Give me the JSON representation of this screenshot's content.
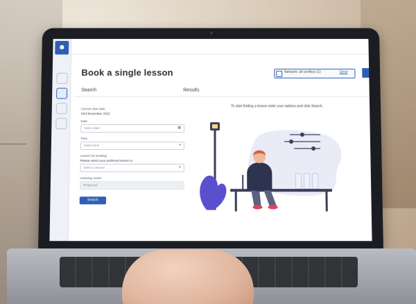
{
  "app": {
    "page_title": "Book a single lesson",
    "network_pill": {
      "text": "Network: all conflicts (1)",
      "link": "Clear"
    }
  },
  "sections": {
    "search": "Search",
    "results": "Results"
  },
  "form": {
    "current_date_label": "Current start date",
    "current_date_value": "23rd November 2022",
    "date_label": "Date",
    "date_placeholder": "Select date",
    "time_label": "Time",
    "time_placeholder": "Select time",
    "lesson_label": "Lesson for booking",
    "lesson_help": "Please select your preferred lesson to",
    "lesson_placeholder": "Select a lesson",
    "learning_label": "Learning centre",
    "learning_placeholder": "Ringwood",
    "search_button": "Search"
  },
  "results": {
    "message": "To start finding a lesson enter your options and click Search."
  },
  "icons": {
    "logo": "logo-icon",
    "side_home": "home-icon",
    "side_calendar": "calendar-icon",
    "side_user": "user-icon",
    "side_settings": "settings-icon"
  },
  "colors": {
    "accent": "#2f5fb3",
    "illustration_purple": "#5a4fcf",
    "illustration_bench": "#3a3f59"
  }
}
